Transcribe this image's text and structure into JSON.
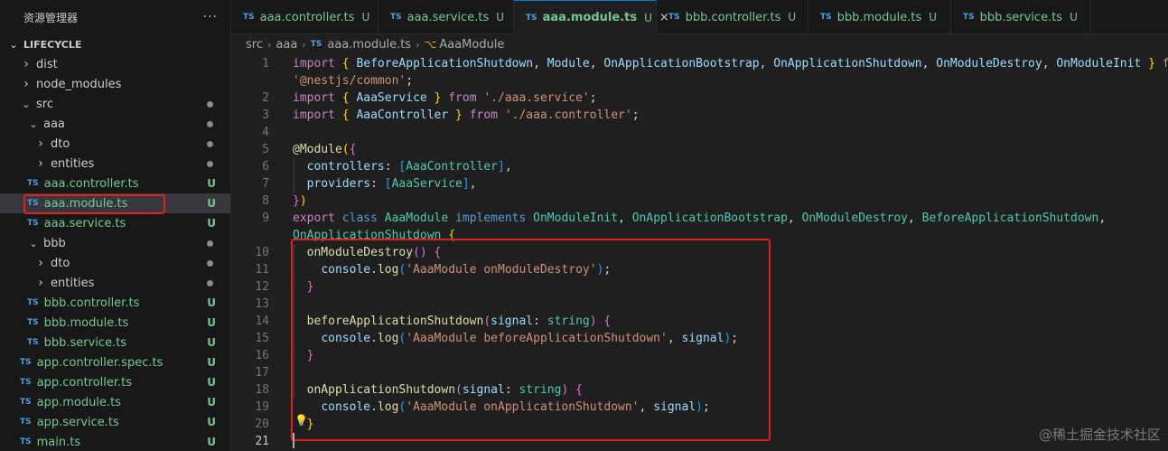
{
  "sidebar": {
    "title": "资源管理器",
    "more": "···",
    "tree": [
      {
        "label": "LIFECYCLE",
        "chevron": "down",
        "root": true
      },
      {
        "label": "dist",
        "chevron": "right"
      },
      {
        "label": "node_modules",
        "chevron": "right"
      },
      {
        "label": "src",
        "chevron": "down",
        "status": "dot"
      },
      {
        "label": "aaa",
        "chevron": "down",
        "status": "dot"
      },
      {
        "label": "dto",
        "chevron": "right",
        "status": "dot"
      },
      {
        "label": "entities",
        "chevron": "right",
        "status": "dot"
      },
      {
        "label": "aaa.controller.ts",
        "ts": "TS",
        "status": "U"
      },
      {
        "label": "aaa.module.ts",
        "ts": "TS",
        "status": "U",
        "selected": true
      },
      {
        "label": "aaa.service.ts",
        "ts": "TS",
        "status": "U"
      },
      {
        "label": "bbb",
        "chevron": "down",
        "status": "dot"
      },
      {
        "label": "dto",
        "chevron": "right",
        "status": "dot"
      },
      {
        "label": "entities",
        "chevron": "right",
        "status": "dot"
      },
      {
        "label": "bbb.controller.ts",
        "ts": "TS",
        "status": "U"
      },
      {
        "label": "bbb.module.ts",
        "ts": "TS",
        "status": "U"
      },
      {
        "label": "bbb.service.ts",
        "ts": "TS",
        "status": "U"
      },
      {
        "label": "app.controller.spec.ts",
        "ts": "TS",
        "status": "U"
      },
      {
        "label": "app.controller.ts",
        "ts": "TS",
        "status": "U"
      },
      {
        "label": "app.module.ts",
        "ts": "TS",
        "status": "U"
      },
      {
        "label": "app.service.ts",
        "ts": "TS",
        "status": "U"
      },
      {
        "label": "main.ts",
        "ts": "TS",
        "status": "U"
      }
    ]
  },
  "tabs": [
    {
      "badge": "TS",
      "label": "aaa.controller.ts",
      "status": "U"
    },
    {
      "badge": "TS",
      "label": "aaa.service.ts",
      "status": "U"
    },
    {
      "badge": "TS",
      "label": "aaa.module.ts",
      "status": "U",
      "active": true,
      "close": "×"
    },
    {
      "badge": "TS",
      "label": "bbb.controller.ts",
      "status": "U"
    },
    {
      "badge": "TS",
      "label": "bbb.module.ts",
      "status": "U"
    },
    {
      "badge": "TS",
      "label": "bbb.service.ts",
      "status": "U"
    }
  ],
  "breadcrumb": {
    "parts": [
      "src",
      "aaa"
    ],
    "file_badge": "TS",
    "file": "aaa.module.ts",
    "symbol_icon": "symbol-class-icon",
    "symbol": "AaaModule"
  },
  "code": [
    {
      "n": "1",
      "tokens": [
        [
          "kw",
          "import"
        ],
        [
          "pu",
          " "
        ],
        [
          "br1",
          "{"
        ],
        [
          "pu",
          " "
        ],
        [
          "vr",
          "BeforeApplicationShutdown"
        ],
        [
          "pu",
          ", "
        ],
        [
          "vr",
          "Module"
        ],
        [
          "pu",
          ", "
        ],
        [
          "vr",
          "OnApplicationBootstrap"
        ],
        [
          "pu",
          ", "
        ],
        [
          "vr",
          "OnApplicationShutdown"
        ],
        [
          "pu",
          ", "
        ],
        [
          "vr",
          "OnModuleDestroy"
        ],
        [
          "pu",
          ", "
        ],
        [
          "vr",
          "OnModuleInit"
        ],
        [
          "pu",
          " "
        ],
        [
          "br1",
          "}"
        ],
        [
          "pu",
          " "
        ],
        [
          "kw",
          "from"
        ]
      ]
    },
    {
      "n": "",
      "tokens": [
        [
          "st",
          "'@nestjs/common'"
        ],
        [
          "pu",
          ";"
        ]
      ]
    },
    {
      "n": "2",
      "tokens": [
        [
          "kw",
          "import"
        ],
        [
          "pu",
          " "
        ],
        [
          "br1",
          "{"
        ],
        [
          "pu",
          " "
        ],
        [
          "vr",
          "AaaService"
        ],
        [
          "pu",
          " "
        ],
        [
          "br1",
          "}"
        ],
        [
          "pu",
          " "
        ],
        [
          "kw",
          "from"
        ],
        [
          "pu",
          " "
        ],
        [
          "st",
          "'./aaa.service'"
        ],
        [
          "pu",
          ";"
        ]
      ]
    },
    {
      "n": "3",
      "tokens": [
        [
          "kw",
          "import"
        ],
        [
          "pu",
          " "
        ],
        [
          "br1",
          "{"
        ],
        [
          "pu",
          " "
        ],
        [
          "vr",
          "AaaController"
        ],
        [
          "pu",
          " "
        ],
        [
          "br1",
          "}"
        ],
        [
          "pu",
          " "
        ],
        [
          "kw",
          "from"
        ],
        [
          "pu",
          " "
        ],
        [
          "st",
          "'./aaa.controller'"
        ],
        [
          "pu",
          ";"
        ]
      ]
    },
    {
      "n": "4",
      "tokens": []
    },
    {
      "n": "5",
      "tokens": [
        [
          "dc",
          "@Module"
        ],
        [
          "br1",
          "("
        ],
        [
          "br2",
          "{"
        ]
      ]
    },
    {
      "n": "6",
      "tokens": [
        [
          "pu",
          "  "
        ],
        [
          "vr",
          "controllers"
        ],
        [
          "pu",
          ": "
        ],
        [
          "br3",
          "["
        ],
        [
          "ty",
          "AaaController"
        ],
        [
          "br3",
          "]"
        ],
        [
          "pu",
          ","
        ]
      ]
    },
    {
      "n": "7",
      "tokens": [
        [
          "pu",
          "  "
        ],
        [
          "vr",
          "providers"
        ],
        [
          "pu",
          ": "
        ],
        [
          "br3",
          "["
        ],
        [
          "ty",
          "AaaService"
        ],
        [
          "br3",
          "]"
        ],
        [
          "pu",
          ","
        ]
      ]
    },
    {
      "n": "8",
      "tokens": [
        [
          "br2",
          "}"
        ],
        [
          "br1",
          ")"
        ]
      ]
    },
    {
      "n": "9",
      "tokens": [
        [
          "kw",
          "export"
        ],
        [
          "pu",
          " "
        ],
        [
          "kw2",
          "class"
        ],
        [
          "pu",
          " "
        ],
        [
          "ty",
          "AaaModule"
        ],
        [
          "pu",
          " "
        ],
        [
          "kw2",
          "implements"
        ],
        [
          "pu",
          " "
        ],
        [
          "ty",
          "OnModuleInit"
        ],
        [
          "pu",
          ", "
        ],
        [
          "ty",
          "OnApplicationBootstrap"
        ],
        [
          "pu",
          ", "
        ],
        [
          "ty",
          "OnModuleDestroy"
        ],
        [
          "pu",
          ", "
        ],
        [
          "ty",
          "BeforeApplicationShutdown"
        ],
        [
          "pu",
          ","
        ]
      ]
    },
    {
      "n": "",
      "tokens": [
        [
          "ty",
          "OnApplicationShutdown"
        ],
        [
          "pu",
          " "
        ],
        [
          "br1",
          "{"
        ]
      ]
    },
    {
      "n": "10",
      "tokens": [
        [
          "pu",
          "  "
        ],
        [
          "fn",
          "onModuleDestroy"
        ],
        [
          "br2",
          "()"
        ],
        [
          "pu",
          " "
        ],
        [
          "br2",
          "{"
        ]
      ]
    },
    {
      "n": "11",
      "tokens": [
        [
          "pu",
          "    "
        ],
        [
          "vr",
          "console"
        ],
        [
          "pu",
          "."
        ],
        [
          "fn",
          "log"
        ],
        [
          "br3",
          "("
        ],
        [
          "st",
          "'AaaModule onModuleDestroy'"
        ],
        [
          "br3",
          ")"
        ],
        [
          "pu",
          ";"
        ]
      ]
    },
    {
      "n": "12",
      "tokens": [
        [
          "pu",
          "  "
        ],
        [
          "br2",
          "}"
        ]
      ]
    },
    {
      "n": "13",
      "tokens": []
    },
    {
      "n": "14",
      "tokens": [
        [
          "pu",
          "  "
        ],
        [
          "fn",
          "beforeApplicationShutdown"
        ],
        [
          "br2",
          "("
        ],
        [
          "vr",
          "signal"
        ],
        [
          "pu",
          ": "
        ],
        [
          "ty",
          "string"
        ],
        [
          "br2",
          ")"
        ],
        [
          "pu",
          " "
        ],
        [
          "br2",
          "{"
        ]
      ]
    },
    {
      "n": "15",
      "tokens": [
        [
          "pu",
          "    "
        ],
        [
          "vr",
          "console"
        ],
        [
          "pu",
          "."
        ],
        [
          "fn",
          "log"
        ],
        [
          "br3",
          "("
        ],
        [
          "st",
          "'AaaModule beforeApplicationShutdown'"
        ],
        [
          "pu",
          ", "
        ],
        [
          "vr",
          "signal"
        ],
        [
          "br3",
          ")"
        ],
        [
          "pu",
          ";"
        ]
      ]
    },
    {
      "n": "16",
      "tokens": [
        [
          "pu",
          "  "
        ],
        [
          "br2",
          "}"
        ]
      ]
    },
    {
      "n": "17",
      "tokens": []
    },
    {
      "n": "18",
      "tokens": [
        [
          "pu",
          "  "
        ],
        [
          "fn",
          "onApplicationShutdown"
        ],
        [
          "br2",
          "("
        ],
        [
          "vr",
          "signal"
        ],
        [
          "pu",
          ": "
        ],
        [
          "ty",
          "string"
        ],
        [
          "br2",
          ")"
        ],
        [
          "pu",
          " "
        ],
        [
          "br2",
          "{"
        ]
      ]
    },
    {
      "n": "19",
      "tokens": [
        [
          "pu",
          "    "
        ],
        [
          "vr",
          "console"
        ],
        [
          "pu",
          "."
        ],
        [
          "fn",
          "log"
        ],
        [
          "br3",
          "("
        ],
        [
          "st",
          "'AaaModule onApplicationShutdown'"
        ],
        [
          "pu",
          ", "
        ],
        [
          "vr",
          "signal"
        ],
        [
          "br3",
          ")"
        ],
        [
          "pu",
          ";"
        ]
      ]
    },
    {
      "n": "20",
      "tokens": [
        [
          "pu",
          "  "
        ],
        [
          "br1",
          "}"
        ]
      ]
    },
    {
      "n": "21",
      "tokens": [],
      "current": true
    }
  ],
  "watermark": "@稀土掘金技术社区",
  "colors": {
    "untracked": "#73c991",
    "accent": "#0078d4",
    "highlight_box": "#e02020",
    "ts_badge": "#4d9ee6"
  }
}
